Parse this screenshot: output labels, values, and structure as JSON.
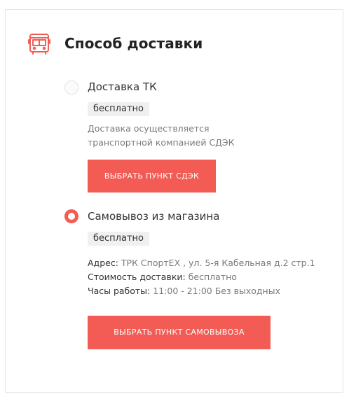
{
  "section": {
    "title": "Способ доставки",
    "icon": "bus-icon",
    "accent_color": "#f25c54"
  },
  "options": [
    {
      "label": "Доставка ТК",
      "selected": false,
      "price_badge": "бесплатно",
      "description_line1": "Доставка осуществляется",
      "description_line2": "транспортной компанией СДЭК",
      "button_label": "ВЫБРАТЬ ПУНКТ СДЭК"
    },
    {
      "label": "Самовывоз из магазина",
      "selected": true,
      "price_badge": "бесплатно",
      "address_label": "Адрес:",
      "address_value": "ТРК СпортЕХ , ул. 5-я Кабельная д.2 стр.1",
      "cost_label": "Стоимость доставки:",
      "cost_value": "бесплатно",
      "hours_label": "Часы работы:",
      "hours_value": "11:00 - 21:00 Без выходных",
      "button_label": "ВЫБРАТЬ ПУНКТ САМОВЫВОЗА"
    }
  ]
}
